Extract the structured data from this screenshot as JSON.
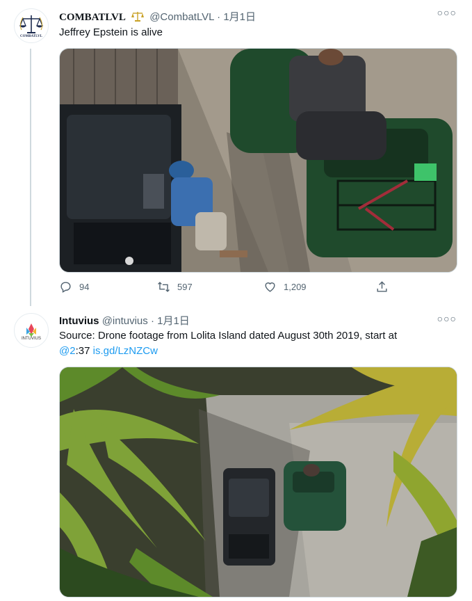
{
  "tweets": [
    {
      "name": "COMBATLVL",
      "verified_icon": "scales-icon",
      "handle": "@CombatLVL",
      "separator": "·",
      "date": "1月1日",
      "text": "Jeffrey Epstein is alive",
      "avatar_label": "COMBATLVL",
      "stats": {
        "replies": "94",
        "retweets": "597",
        "likes": "1,209"
      }
    },
    {
      "name": "Intuvius",
      "handle": "@intuvius",
      "separator": "·",
      "date": "1月1日",
      "text_main": "Source: Drone footage from Lolita Island dated August 30th 2019, start at",
      "mention": "@2",
      "mention_rest": ":37",
      "link": "is.gd/LzNZCw",
      "avatar_label": "INTUVIUS"
    }
  ],
  "colors": {
    "accent": "#1d9bf0",
    "muted": "#536471",
    "atv_green": "#1f4a2c"
  }
}
